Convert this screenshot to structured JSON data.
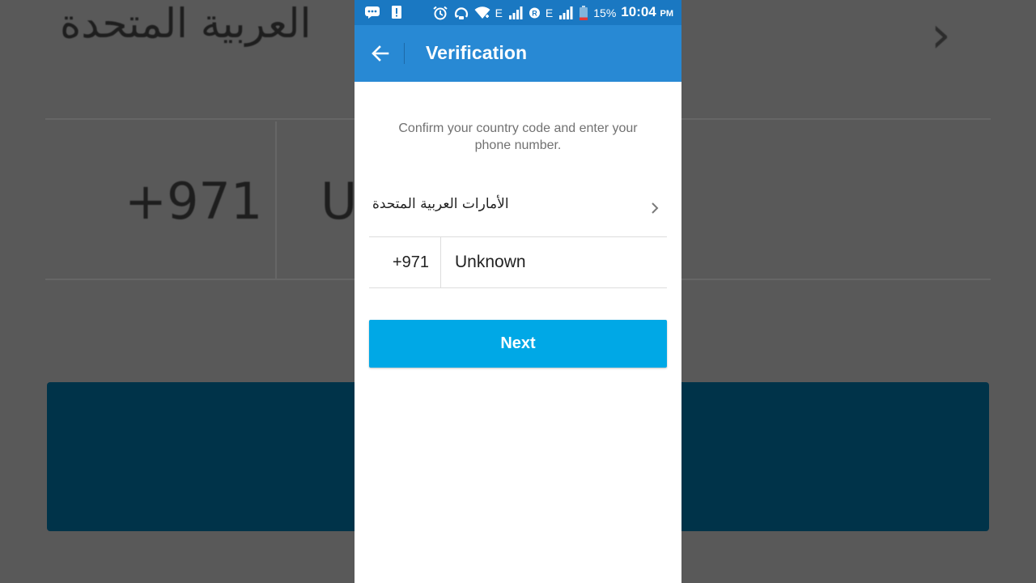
{
  "status_bar": {
    "network_type_1": "E",
    "roaming_marker": "R",
    "network_type_2": "E",
    "battery_percent": "15%",
    "time": "10:04",
    "ampm": "PM"
  },
  "app_bar": {
    "title": "Verification"
  },
  "form": {
    "instruction": "Confirm your country code and enter your phone number.",
    "country_name": "الأمارات العربية المتحدة",
    "country_code": "+971",
    "phone_number": "Unknown",
    "next_label": "Next"
  },
  "background_zoom": {
    "country_fragment": "العربية المتحدة",
    "code": "+971",
    "number_fragment": "U"
  },
  "colors": {
    "status_bar": "#1a78c2",
    "app_bar": "#2889d4",
    "next_button": "#00a8e6",
    "backdrop": "#595959"
  }
}
